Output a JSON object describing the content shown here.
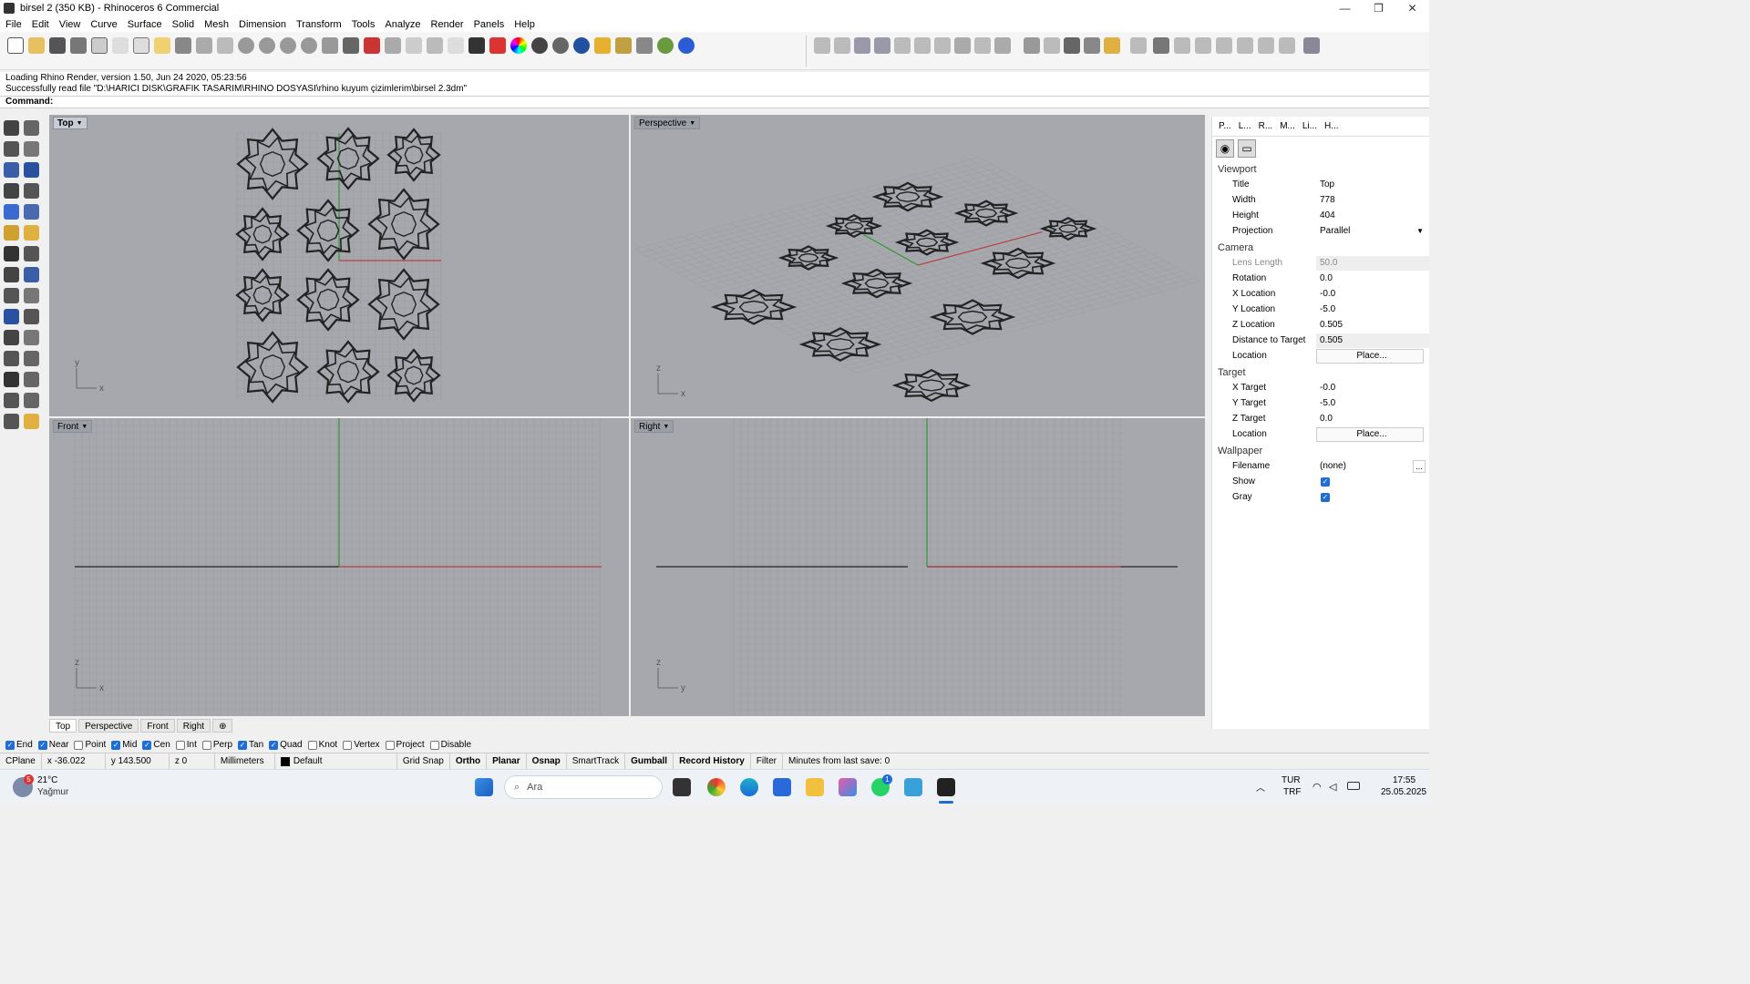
{
  "window": {
    "title": "birsel 2 (350 KB) - Rhinoceros 6 Commercial",
    "minimize": "—",
    "maximize": "❐",
    "close": "✕"
  },
  "menu": [
    "File",
    "Edit",
    "View",
    "Curve",
    "Surface",
    "Solid",
    "Mesh",
    "Dimension",
    "Transform",
    "Tools",
    "Analyze",
    "Render",
    "Panels",
    "Help"
  ],
  "history": [
    "Loading Rhino Render, version 1.50, Jun 24 2020, 05:23:56",
    "Successfully read file \"D:\\HARICI DISK\\GRAFIK TASARIM\\RHINO DOSYASI\\rhino kuyum çizimlerim\\birsel 2.3dm\""
  ],
  "command": {
    "label": "Command:",
    "value": ""
  },
  "viewports": {
    "top": "Top",
    "perspective": "Perspective",
    "front": "Front",
    "right": "Right"
  },
  "viewport_tabs": [
    "Top",
    "Perspective",
    "Front",
    "Right",
    "⊕"
  ],
  "panel": {
    "tabs": [
      "P...",
      "L...",
      "R...",
      "M...",
      "Li...",
      "H..."
    ],
    "viewport_section": "Viewport",
    "title_label": "Title",
    "title_value": "Top",
    "width_label": "Width",
    "width_value": "778",
    "height_label": "Height",
    "height_value": "404",
    "projection_label": "Projection",
    "projection_value": "Parallel",
    "camera_section": "Camera",
    "lens_label": "Lens Length",
    "lens_value": "50.0",
    "rotation_label": "Rotation",
    "rotation_value": "0.0",
    "xloc_label": "X Location",
    "xloc_value": "-0.0",
    "yloc_label": "Y Location",
    "yloc_value": "-5.0",
    "zloc_label": "Z Location",
    "zloc_value": "0.505",
    "dist_label": "Distance to Target",
    "dist_value": "0.505",
    "location_label": "Location",
    "place_button": "Place...",
    "target_section": "Target",
    "xt_label": "X Target",
    "xt_value": "-0.0",
    "yt_label": "Y Target",
    "yt_value": "-5.0",
    "zt_label": "Z Target",
    "zt_value": "0.0",
    "tloc_label": "Location",
    "tplace_button": "Place...",
    "wallpaper_section": "Wallpaper",
    "filename_label": "Filename",
    "filename_value": "(none)",
    "more_button": "...",
    "show_label": "Show",
    "show_checked": true,
    "gray_label": "Gray",
    "gray_checked": true
  },
  "osnap": [
    {
      "label": "End",
      "checked": true
    },
    {
      "label": "Near",
      "checked": true
    },
    {
      "label": "Point",
      "checked": false
    },
    {
      "label": "Mid",
      "checked": true
    },
    {
      "label": "Cen",
      "checked": true
    },
    {
      "label": "Int",
      "checked": false
    },
    {
      "label": "Perp",
      "checked": false
    },
    {
      "label": "Tan",
      "checked": true
    },
    {
      "label": "Quad",
      "checked": true
    },
    {
      "label": "Knot",
      "checked": false
    },
    {
      "label": "Vertex",
      "checked": false
    },
    {
      "label": "Project",
      "checked": false
    },
    {
      "label": "Disable",
      "checked": false
    }
  ],
  "status": {
    "cplane": "CPlane",
    "x": "x -36.022",
    "y": "y 143.500",
    "z": "z 0",
    "units": "Millimeters",
    "layer": "Default",
    "grid_snap": "Grid Snap",
    "ortho": "Ortho",
    "planar": "Planar",
    "osnap": "Osnap",
    "smarttrack": "SmartTrack",
    "gumball": "Gumball",
    "record_history": "Record History",
    "filter": "Filter",
    "last_save": "Minutes from last save: 0"
  },
  "taskbar": {
    "weather_temp": "21°C",
    "weather_desc": "Yağmur",
    "weather_badge": "5",
    "search": "Ara",
    "lang1": "TUR",
    "lang2": "TRF",
    "time": "17:55",
    "date": "25.05.2025",
    "whatsapp_badge": "1"
  },
  "colors": {
    "viewport_bg": "#a6a8ae",
    "grid": "#9a9ca2",
    "x_axis": "#b84040",
    "y_axis": "#2f9a2f",
    "accent": "#1f6dd6"
  }
}
